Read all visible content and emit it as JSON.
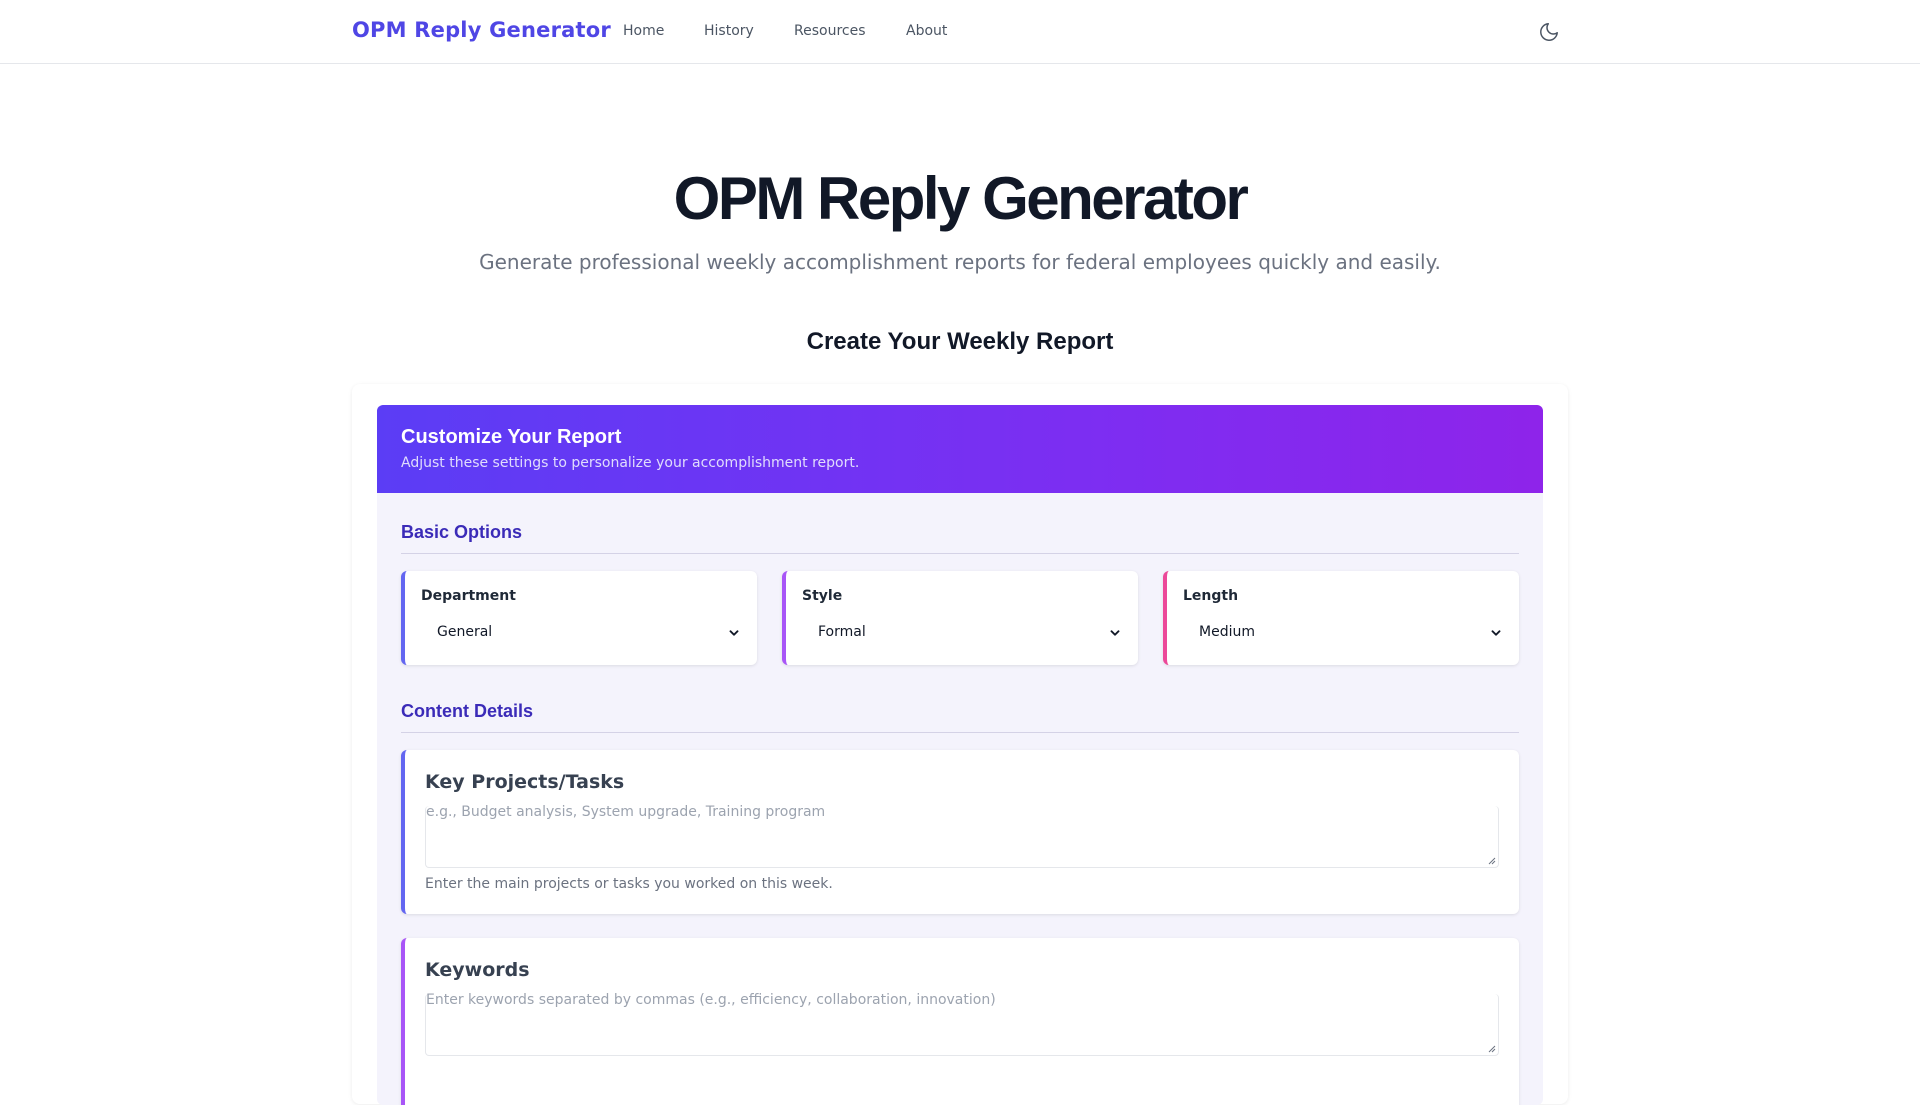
{
  "nav": {
    "brand": "OPM Reply Generator",
    "links": [
      "Home",
      "History",
      "Resources",
      "About"
    ],
    "theme_toggle_icon": "moon-icon"
  },
  "hero": {
    "title": "OPM Reply Generator",
    "subtitle": "Generate professional weekly accomplishment reports for federal employees quickly and easily."
  },
  "section_heading": "Create Your Weekly Report",
  "panel": {
    "title": "Customize Your Report",
    "subtitle": "Adjust these settings to personalize your accomplishment report.",
    "gradient": [
      "#5b3df5",
      "#8e24ea"
    ]
  },
  "basic_options": {
    "title": "Basic Options",
    "fields": [
      {
        "label": "Department",
        "value": "General",
        "accent": "#6366f1"
      },
      {
        "label": "Style",
        "value": "Formal",
        "accent": "#a855f7"
      },
      {
        "label": "Length",
        "value": "Medium",
        "accent": "#ec4899"
      }
    ]
  },
  "content_details": {
    "title": "Content Details",
    "fields": [
      {
        "label": "Key Projects/Tasks",
        "placeholder": "e.g., Budget analysis, System upgrade, Training program",
        "help": "Enter the main projects or tasks you worked on this week.",
        "accent": "#6366f1"
      },
      {
        "label": "Keywords",
        "placeholder": "Enter keywords separated by commas (e.g., efficiency, collaboration, innovation)",
        "help": "",
        "accent": "#a855f7"
      }
    ]
  }
}
